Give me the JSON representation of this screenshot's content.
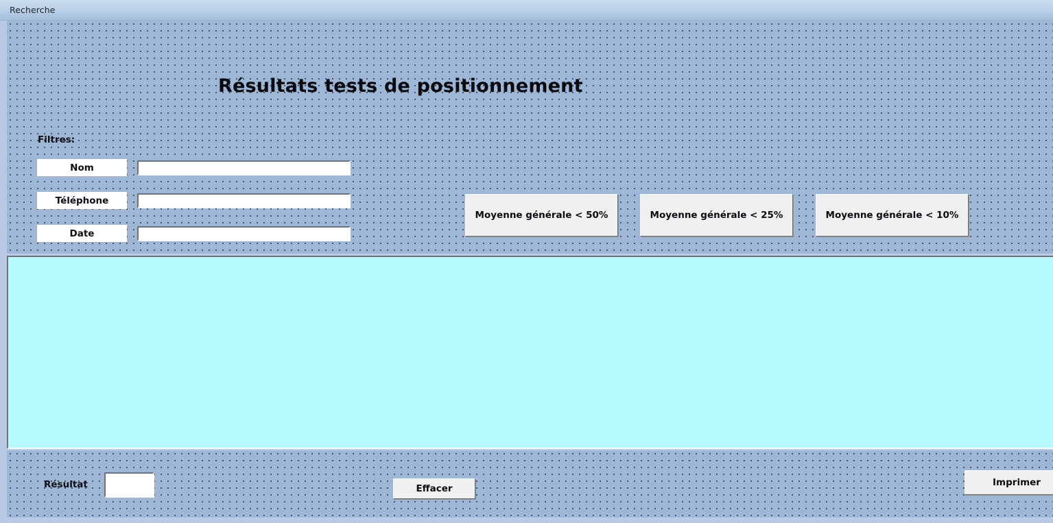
{
  "window": {
    "title": "Recherche"
  },
  "header": {
    "page_title": "Résultats tests de positionnement"
  },
  "filters": {
    "section_label": "Filtres:",
    "fields": [
      {
        "label": "Nom",
        "value": "",
        "placeholder": ""
      },
      {
        "label": "Téléphone",
        "value": "",
        "placeholder": ""
      },
      {
        "label": "Date",
        "value": "",
        "placeholder": ""
      }
    ]
  },
  "quick_filters": {
    "buttons": [
      {
        "label": "Moyenne générale < 50%"
      },
      {
        "label": "Moyenne générale < 25%"
      },
      {
        "label": "Moyenne générale < 10%"
      }
    ]
  },
  "results": {
    "items": [],
    "empty_text": ""
  },
  "footer": {
    "result_label": "Résultat",
    "result_value": "",
    "clear_button": "Effacer",
    "print_button": "Imprimer"
  },
  "colors": {
    "titlebar_top": "#c9dcee",
    "titlebar_bottom": "#a6bfdb",
    "panel_background": "#9fb7d6",
    "panel_dot": "#2f3a49",
    "results_background": "#b6fcfc",
    "button_face": "#f0f0f0",
    "input_background": "#ffffff",
    "text": "#0a0d12",
    "window_frame": "#b9cbe4"
  }
}
